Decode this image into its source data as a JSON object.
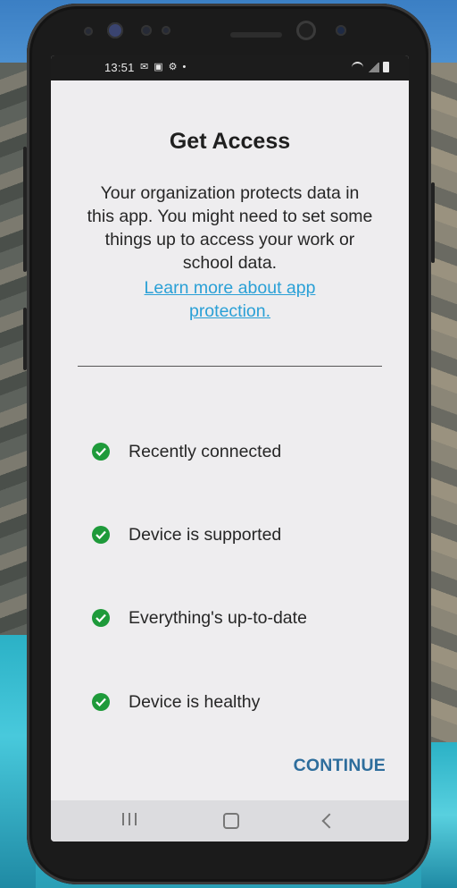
{
  "status_bar": {
    "time": "13:51",
    "icons": [
      "message-icon",
      "image-icon",
      "gear-icon",
      "dot-icon"
    ],
    "right_icons": [
      "wifi-icon",
      "signal-icon",
      "battery-icon"
    ]
  },
  "title": "Get Access",
  "description": "Your organization protects data in this app. You might need to set some things up to access your work or school data.",
  "learn_more": "Learn more about app protection.",
  "checks": [
    {
      "label": "Recently connected",
      "status": "ok"
    },
    {
      "label": "Device is supported",
      "status": "ok"
    },
    {
      "label": "Everything's up-to-date",
      "status": "ok"
    },
    {
      "label": "Device is healthy",
      "status": "ok"
    }
  ],
  "continue_label": "CONTINUE",
  "colors": {
    "check_green": "#1e9a3a",
    "link_blue": "#2aa0d6",
    "continue_blue": "#2d6d9c"
  },
  "nav_bar": [
    "recent-apps-icon",
    "home-icon",
    "back-icon"
  ]
}
